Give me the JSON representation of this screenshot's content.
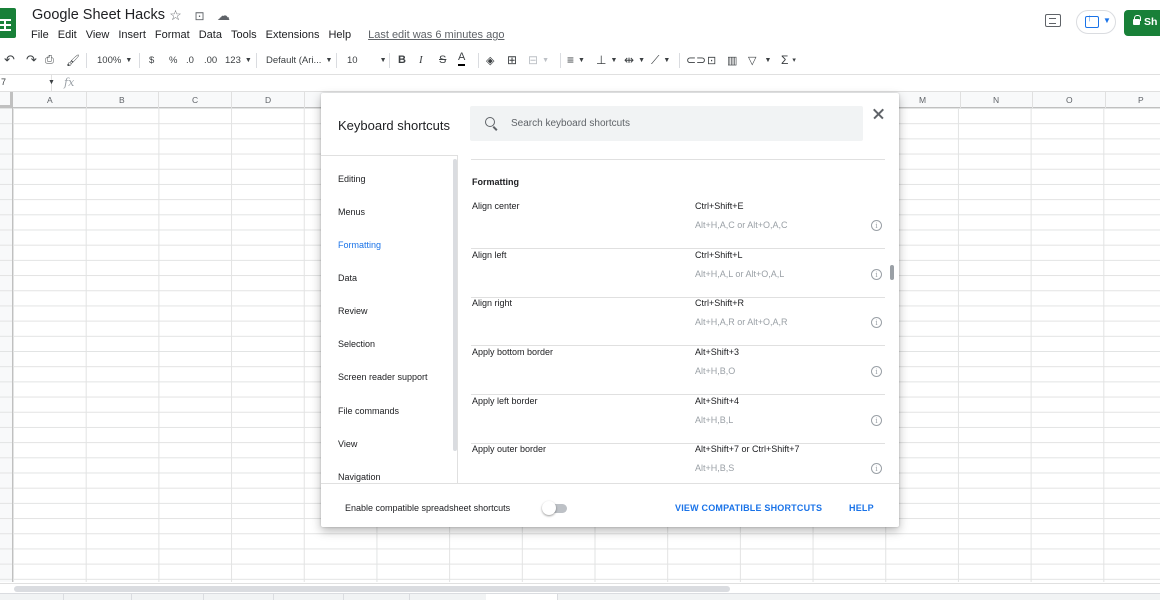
{
  "header": {
    "doc_title": "Google Sheet Hacks",
    "menus": [
      "File",
      "Edit",
      "View",
      "Insert",
      "Format",
      "Data",
      "Tools",
      "Extensions",
      "Help"
    ],
    "last_edit": "Last edit was 6 minutes ago",
    "share_label": "Sh"
  },
  "toolbar": {
    "zoom": "100%",
    "currency": "$",
    "percent": "%",
    "decimal_decrease": ".0",
    "decimal_increase": ".00",
    "more_formats": "123",
    "font": "Default (Ari...",
    "font_size": "10",
    "bold": "B",
    "italic": "I",
    "strike": "S",
    "text_color": "A",
    "sum": "Σ"
  },
  "formula_bar": {
    "name_box": "7",
    "fx": "fx"
  },
  "grid": {
    "columns": [
      "A",
      "B",
      "C",
      "D",
      "M",
      "N",
      "O",
      "P"
    ]
  },
  "dialog": {
    "title": "Keyboard shortcuts",
    "search_placeholder": "Search keyboard shortcuts",
    "categories": [
      {
        "label": "Editing",
        "active": false
      },
      {
        "label": "Menus",
        "active": false
      },
      {
        "label": "Formatting",
        "active": true
      },
      {
        "label": "Data",
        "active": false
      },
      {
        "label": "Review",
        "active": false
      },
      {
        "label": "Selection",
        "active": false
      },
      {
        "label": "Screen reader support",
        "active": false
      },
      {
        "label": "File commands",
        "active": false
      },
      {
        "label": "View",
        "active": false
      },
      {
        "label": "Navigation",
        "active": false
      }
    ],
    "section_title": "Formatting",
    "shortcuts": [
      {
        "name": "Align center",
        "primary": "Ctrl+Shift+E",
        "alt": "Alt+H,A,C or Alt+O,A,C"
      },
      {
        "name": "Align left",
        "primary": "Ctrl+Shift+L",
        "alt": "Alt+H,A,L or Alt+O,A,L"
      },
      {
        "name": "Align right",
        "primary": "Ctrl+Shift+R",
        "alt": "Alt+H,A,R or Alt+O,A,R"
      },
      {
        "name": "Apply bottom border",
        "primary": "Alt+Shift+3",
        "alt": "Alt+H,B,O"
      },
      {
        "name": "Apply left border",
        "primary": "Alt+Shift+4",
        "alt": "Alt+H,B,L"
      },
      {
        "name": "Apply outer border",
        "primary": "Alt+Shift+7 or Ctrl+Shift+7",
        "alt": "Alt+H,B,S"
      }
    ],
    "footer": {
      "compat_label": "Enable compatible spreadsheet shortcuts",
      "view_compat": "VIEW COMPATIBLE SHORTCUTS",
      "help": "HELP"
    }
  },
  "colors": {
    "accent": "#1a73e8",
    "sheets_green": "#188038"
  }
}
